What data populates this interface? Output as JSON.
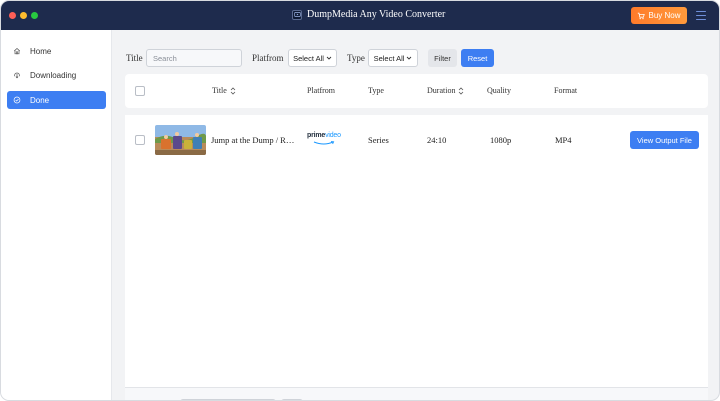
{
  "app": {
    "title": "DumpMedia Any Video Converter",
    "buy_label": "Buy Now"
  },
  "colors": {
    "titlebar": "#1e2b4d",
    "accent": "#3d7ef2",
    "buy": "#ff8a33"
  },
  "sidebar": {
    "items": [
      {
        "label": "Home",
        "icon": "home-icon"
      },
      {
        "label": "Downloading",
        "icon": "download-icon"
      },
      {
        "label": "Done",
        "icon": "check-circle-icon",
        "active": true
      }
    ]
  },
  "filters": {
    "title_label": "Title",
    "search_placeholder": "Search",
    "search_value": "",
    "platform_label": "Platfrom",
    "platform_value": "Select All",
    "type_label": "Type",
    "type_value": "Select All",
    "filter_label": "Filter",
    "reset_label": "Reset"
  },
  "table": {
    "headers": {
      "title": "Title",
      "platform": "Platfrom",
      "type": "Type",
      "duration": "Duration",
      "quality": "Quality",
      "format": "Format"
    },
    "rows": [
      {
        "title": "Jump at the Dump / R…",
        "platform_logo_main": "prime",
        "platform_logo_sub": "video",
        "type": "Series",
        "duration": "24:10",
        "quality": "1080p",
        "format": "MP4",
        "action": "View Output File"
      }
    ]
  }
}
